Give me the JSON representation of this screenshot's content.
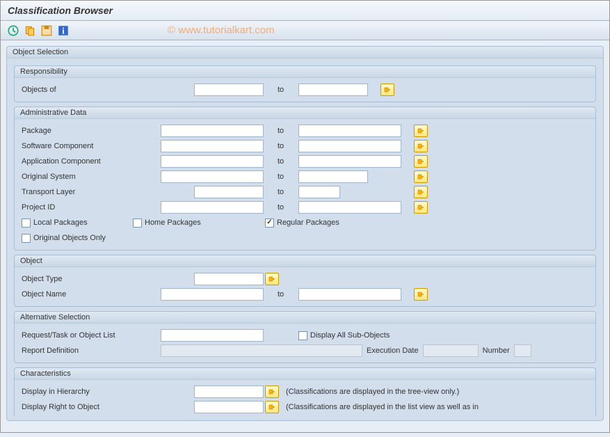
{
  "title": "Classification Browser",
  "watermark": "© www.tutorialkart.com",
  "sections": {
    "object_selection": {
      "title": "Object Selection",
      "responsibility": {
        "title": "Responsibility",
        "objects_of": "Objects of",
        "to": "to"
      },
      "admin_data": {
        "title": "Administrative Data",
        "rows": {
          "package": "Package",
          "software_component": "Software Component",
          "application_component": "Application Component",
          "original_system": "Original System",
          "transport_layer": "Transport Layer",
          "project_id": "Project ID"
        },
        "to": "to",
        "checkboxes": {
          "local_packages": "Local Packages",
          "home_packages": "Home Packages",
          "regular_packages": "Regular Packages",
          "original_objects_only": "Original Objects Only"
        }
      },
      "object": {
        "title": "Object",
        "object_type": "Object Type",
        "object_name": "Object Name",
        "to": "to"
      },
      "alternative_selection": {
        "title": "Alternative Selection",
        "request_task": "Request/Task or Object List",
        "display_all_sub": "Display All Sub-Objects",
        "report_definition": "Report Definition",
        "execution_date": "Execution Date",
        "number": "Number"
      },
      "characteristics": {
        "title": "Characteristics",
        "display_hierarchy": "Display in Hierarchy",
        "display_right": "Display Right to Object",
        "note1": "(Classifications are displayed in the tree-view only.)",
        "note2": "(Classifications are displayed in the list view as well as in"
      }
    }
  }
}
